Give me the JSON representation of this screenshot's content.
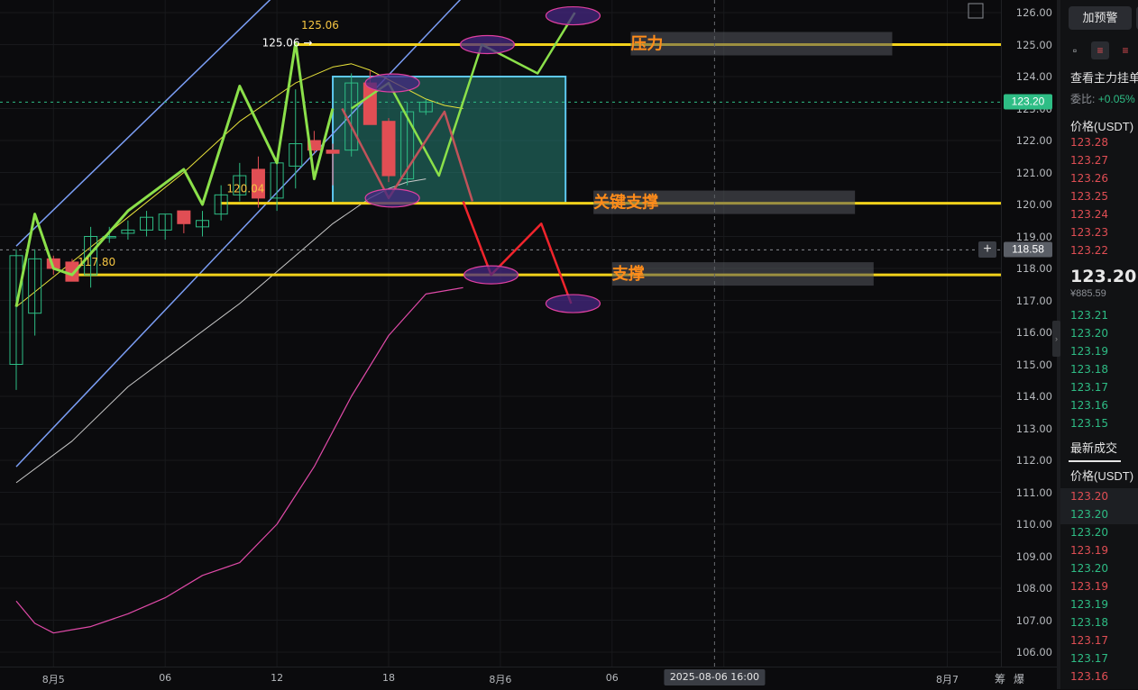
{
  "chart_data": {
    "type": "candlestick",
    "ylim": [
      105.5,
      126.5
    ],
    "y_ticks": [
      "106.00",
      "107.00",
      "108.00",
      "109.00",
      "110.00",
      "111.00",
      "112.00",
      "113.00",
      "114.00",
      "115.00",
      "116.00",
      "117.00",
      "118.00",
      "119.00",
      "120.00",
      "121.00",
      "122.00",
      "123.00",
      "124.00",
      "125.00",
      "126.00"
    ],
    "x_ticks": [
      {
        "label": "8月5",
        "x": 2
      },
      {
        "label": "06",
        "x": 8
      },
      {
        "label": "12",
        "x": 14
      },
      {
        "label": "18",
        "x": 20
      },
      {
        "label": "8月6",
        "x": 26
      },
      {
        "label": "06",
        "x": 32
      },
      {
        "label": "12",
        "x": 38
      },
      {
        "label": "8月7",
        "x": 50
      }
    ],
    "candles": [
      {
        "o": 115.0,
        "h": 118.6,
        "l": 114.2,
        "c": 118.4
      },
      {
        "o": 116.6,
        "h": 118.6,
        "l": 115.9,
        "c": 118.3
      },
      {
        "o": 118.3,
        "h": 118.4,
        "l": 117.8,
        "c": 118.0
      },
      {
        "o": 118.2,
        "h": 118.3,
        "l": 117.7,
        "c": 117.6
      },
      {
        "o": 117.8,
        "h": 119.3,
        "l": 117.4,
        "c": 119.0
      },
      {
        "o": 119.0,
        "h": 119.3,
        "l": 118.8,
        "c": 119.0
      },
      {
        "o": 119.1,
        "h": 119.5,
        "l": 118.9,
        "c": 119.2
      },
      {
        "o": 119.2,
        "h": 119.8,
        "l": 119.0,
        "c": 119.6
      },
      {
        "o": 119.2,
        "h": 119.6,
        "l": 118.9,
        "c": 119.7
      },
      {
        "o": 119.8,
        "h": 119.7,
        "l": 119.1,
        "c": 119.4
      },
      {
        "o": 119.3,
        "h": 119.8,
        "l": 119.0,
        "c": 119.5
      },
      {
        "o": 119.7,
        "h": 120.6,
        "l": 119.5,
        "c": 120.3
      },
      {
        "o": 120.3,
        "h": 121.3,
        "l": 120.1,
        "c": 120.9
      },
      {
        "o": 121.1,
        "h": 121.5,
        "l": 119.9,
        "c": 120.2
      },
      {
        "o": 120.2,
        "h": 121.3,
        "l": 119.8,
        "c": 121.3
      },
      {
        "o": 121.2,
        "h": 123.6,
        "l": 120.5,
        "c": 121.9
      },
      {
        "o": 122.0,
        "h": 122.3,
        "l": 121.6,
        "c": 121.7
      },
      {
        "o": 121.7,
        "h": 121.9,
        "l": 120.6,
        "c": 121.6
      },
      {
        "o": 121.7,
        "h": 124.1,
        "l": 121.5,
        "c": 123.8
      },
      {
        "o": 123.8,
        "h": 124.2,
        "l": 122.5,
        "c": 122.5
      },
      {
        "o": 122.6,
        "h": 122.7,
        "l": 120.7,
        "c": 120.9
      },
      {
        "o": 120.8,
        "h": 123.2,
        "l": 120.6,
        "c": 122.9
      },
      {
        "o": 122.9,
        "h": 123.3,
        "l": 122.8,
        "c": 123.2
      }
    ],
    "ma_yellow": [
      [
        0,
        116.8
      ],
      [
        3,
        118.2
      ],
      [
        6,
        119.6
      ],
      [
        9,
        121.0
      ],
      [
        12,
        122.6
      ],
      [
        15,
        123.8
      ],
      [
        17,
        124.3
      ],
      [
        18,
        124.4
      ],
      [
        19,
        124.2
      ],
      [
        20,
        123.9
      ],
      [
        21,
        123.6
      ],
      [
        22,
        123.3
      ],
      [
        23,
        123.1
      ],
      [
        24,
        123.0
      ]
    ],
    "ma_white": [
      [
        0,
        111.3
      ],
      [
        3,
        112.6
      ],
      [
        6,
        114.3
      ],
      [
        9,
        115.6
      ],
      [
        12,
        116.9
      ],
      [
        15,
        118.4
      ],
      [
        17,
        119.4
      ],
      [
        18,
        119.8
      ],
      [
        19,
        120.2
      ],
      [
        20,
        120.5
      ],
      [
        21,
        120.7
      ],
      [
        22,
        120.8
      ]
    ],
    "ma_pink": [
      [
        0,
        107.6
      ],
      [
        1,
        106.9
      ],
      [
        2,
        106.6
      ],
      [
        3,
        106.7
      ],
      [
        4,
        106.8
      ],
      [
        6,
        107.2
      ],
      [
        8,
        107.7
      ],
      [
        10,
        108.4
      ],
      [
        12,
        108.8
      ],
      [
        14,
        110.0
      ],
      [
        16,
        111.8
      ],
      [
        18,
        114.0
      ],
      [
        20,
        115.9
      ],
      [
        22,
        117.2
      ],
      [
        24,
        117.4
      ]
    ],
    "channel_lines": [
      {
        "from": [
          0,
          118.7
        ],
        "to": [
          20,
          130.0
        ]
      },
      {
        "from": [
          0,
          111.8
        ],
        "to": [
          24,
          126.5
        ]
      }
    ],
    "swing_line": [
      [
        0,
        116.8
      ],
      [
        1,
        119.7
      ],
      [
        2,
        118.0
      ],
      [
        3,
        117.8
      ],
      [
        6,
        119.8
      ],
      [
        9,
        121.1
      ],
      [
        10,
        120.0
      ],
      [
        12,
        123.7
      ],
      [
        14,
        121.3
      ],
      [
        15,
        125.06
      ],
      [
        16,
        120.8
      ],
      [
        17,
        123.0
      ]
    ],
    "horizontal_levels": [
      {
        "label": "压力",
        "value": 125.0,
        "x_from": 15,
        "label_at": 33
      },
      {
        "label": "关键支撑",
        "value": 120.04,
        "x_from": 11,
        "label_at": 31
      },
      {
        "label": "支撑",
        "value": 117.8,
        "x_from": 3,
        "label_at": 32
      }
    ],
    "point_labels": [
      {
        "text": "125.06 →",
        "x": 13.2,
        "y": 125.06,
        "color": "#ffffff"
      },
      {
        "text": "125.06",
        "x": 15.3,
        "y": 125.6,
        "color": "#f5c542"
      },
      {
        "text": "120.04",
        "x": 11.3,
        "y": 120.5,
        "color": "#f5c542"
      },
      {
        "text": "117.80",
        "x": 3.3,
        "y": 118.2,
        "color": "#f5c542"
      }
    ],
    "range_box": {
      "x0": 17,
      "x1": 29.5,
      "y0": 120.04,
      "y1": 124.0
    },
    "scenario_up": [
      [
        18,
        123.0
      ],
      [
        20,
        123.8
      ],
      [
        22.7,
        120.9
      ],
      [
        25,
        125.0
      ],
      [
        28,
        124.1
      ],
      [
        30,
        126.0
      ]
    ],
    "scenario_mid": [
      [
        17.5,
        123.0
      ],
      [
        20,
        120.2
      ],
      [
        23,
        122.9
      ],
      [
        24.5,
        120.1
      ]
    ],
    "scenario_down": [
      [
        24,
        120.1
      ],
      [
        25.5,
        117.8
      ],
      [
        28.2,
        119.4
      ],
      [
        29.8,
        116.9
      ]
    ],
    "ellipses": [
      [
        20.2,
        123.8
      ],
      [
        25.3,
        125.0
      ],
      [
        29.9,
        125.9
      ],
      [
        20.2,
        120.2
      ],
      [
        25.5,
        117.8
      ],
      [
        29.9,
        116.9
      ]
    ],
    "dashed_levels": [
      123.2,
      118.58
    ],
    "time_cursor_x": 37.5,
    "time_cursor_label": "2025-08-06 16:00",
    "last_price_label": "123.20",
    "crosshair_price_label": "118.58"
  },
  "time_axis_icons": {
    "a": "筹",
    "b": "爆"
  },
  "side_panel": {
    "alert_button": "加预警",
    "main_orders": "查看主力挂单",
    "ratio_label": "委比:",
    "ratio_value": "+0.05%",
    "price_header": "价格(USDT)",
    "asks": [
      "123.28",
      "123.27",
      "123.26",
      "123.25",
      "123.24",
      "123.23",
      "123.22"
    ],
    "last_price": "123.20",
    "last_price_cny": "¥885.59",
    "bids": [
      "123.21",
      "123.20",
      "123.19",
      "123.18",
      "123.17",
      "123.16",
      "123.15"
    ],
    "trades_tab": "最新成交",
    "trades_header": "价格(USDT)",
    "trades": [
      {
        "price": "123.20",
        "side": "sell"
      },
      {
        "price": "123.20",
        "side": "buy"
      },
      {
        "price": "123.20",
        "side": "buy"
      },
      {
        "price": "123.19",
        "side": "sell"
      },
      {
        "price": "123.20",
        "side": "buy"
      },
      {
        "price": "123.19",
        "side": "sell"
      },
      {
        "price": "123.19",
        "side": "buy"
      },
      {
        "price": "123.18",
        "side": "buy"
      },
      {
        "price": "123.17",
        "side": "sell"
      },
      {
        "price": "123.17",
        "side": "buy"
      },
      {
        "price": "123.16",
        "side": "sell"
      }
    ]
  }
}
